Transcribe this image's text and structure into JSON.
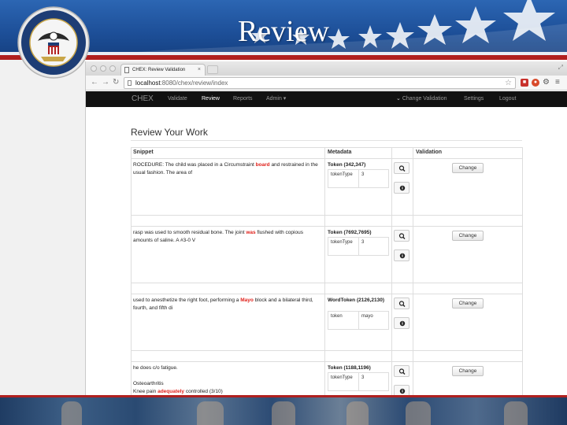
{
  "slide": {
    "title": "Review"
  },
  "browser": {
    "tab_title": "CHEX: Review Validation",
    "tab_close": "×",
    "url_host": "localhost",
    "url_path": ":8080/chex/review/index"
  },
  "icons": {
    "back": "back-arrow-icon",
    "forward": "forward-arrow-icon",
    "reload": "reload-icon",
    "bookmark": "star-icon",
    "zoom": "magnifier-icon",
    "info": "info-icon",
    "caret": "chevron-down-icon"
  },
  "app_nav": {
    "brand": "CHEX",
    "items": [
      "Validate",
      "Review",
      "Reports",
      "Admin"
    ],
    "admin_caret": "▾",
    "right_items": [
      "Change Validation",
      "Settings",
      "Logout"
    ],
    "change_validation_prefix": "⌄"
  },
  "page": {
    "heading": "Review Your Work",
    "columns": [
      "Snippet",
      "Metadata",
      "",
      "Validation"
    ]
  },
  "rows": [
    {
      "snippet_before": "ROCEDURE: The child was placed in a Circumstraint ",
      "snippet_highlight": "board",
      "snippet_after": " and restrained in the usual fashion.  The area of",
      "meta_title": "Token (342,347)",
      "meta_key": "tokenType",
      "meta_value": "3",
      "button": "Change"
    },
    {
      "snippet_before": "rasp was used to smooth residual bone.  The joint ",
      "snippet_highlight": "was",
      "snippet_after": " flushed with copious amounts of saline.  A #3-0 V",
      "meta_title": "Token (7692,7695)",
      "meta_key": "tokenType",
      "meta_value": "3",
      "button": "Change"
    },
    {
      "snippet_before": " used to anesthetize the right foot, performing a ",
      "snippet_highlight": "Mayo",
      "snippet_after": " block and a bilateral third, fourth, and fifth di",
      "meta_title": "WordToken (2126,2130)",
      "meta_key": "token",
      "meta_value": "mayo",
      "button": "Change"
    },
    {
      "snippet_line1": "he does c/o fatigue.",
      "snippet_line2": "Osteoarthritis",
      "snippet_line3_before": "Knee pain ",
      "snippet_line3_highlight": "adequately",
      "snippet_line3_after": " controlled (3/10)",
      "meta_title": "Token (1188,1196)",
      "meta_key": "tokenType",
      "meta_value": "3",
      "button": "Change"
    }
  ],
  "colors": {
    "highlight": "#e0211b",
    "navbar": "#111111",
    "header_blue": "#1d4f98",
    "header_red": "#b0201f"
  }
}
